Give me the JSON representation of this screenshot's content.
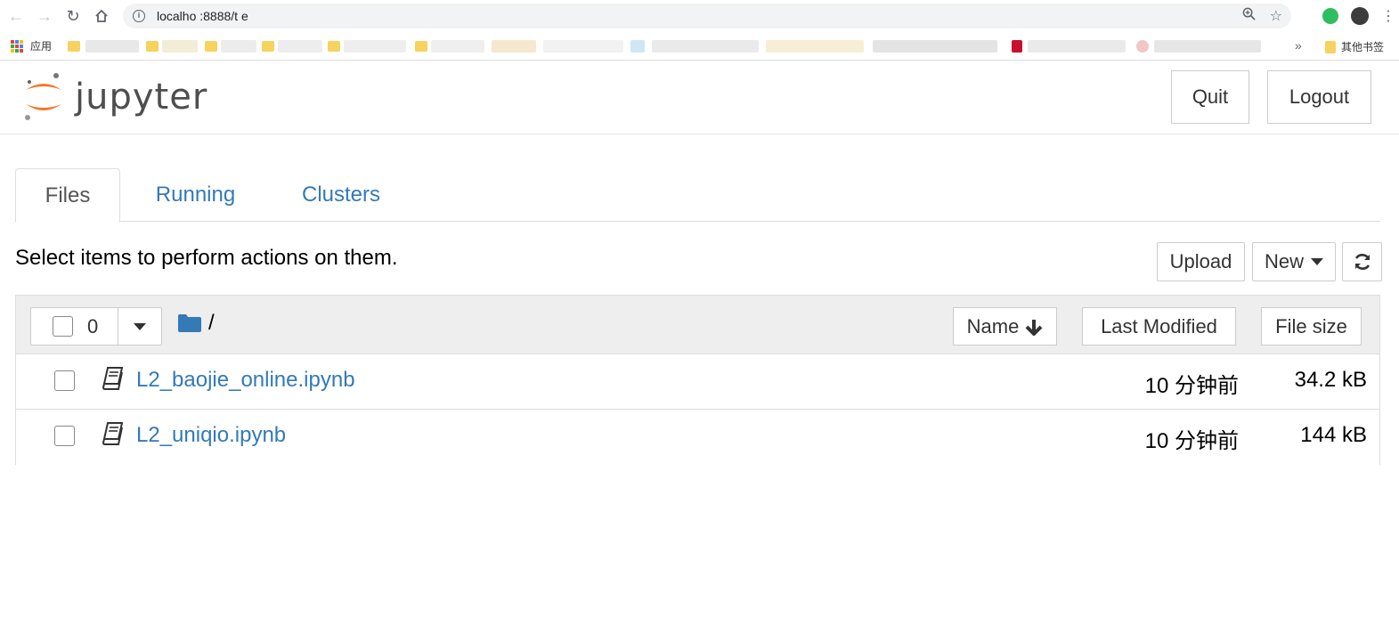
{
  "browser": {
    "url": "localho  :8888/t  e",
    "bookmarks_apps_label": "应用",
    "bookmarks_other_label": "其他书签",
    "bookmarks_more": "»"
  },
  "header": {
    "logo_text": "jupyter",
    "quit_label": "Quit",
    "logout_label": "Logout"
  },
  "tabs": [
    {
      "label": "Files",
      "active": true
    },
    {
      "label": "Running",
      "active": false
    },
    {
      "label": "Clusters",
      "active": false
    }
  ],
  "actions": {
    "hint": "Select items to perform actions on them.",
    "upload_label": "Upload",
    "new_label": "New"
  },
  "file_list": {
    "selected_count": "0",
    "breadcrumb": "/",
    "columns": {
      "name": "Name",
      "last_modified": "Last Modified",
      "file_size": "File size"
    },
    "rows": [
      {
        "name": "L2_baojie_online.ipynb",
        "modified": "10 分钟前",
        "size": "34.2 kB"
      },
      {
        "name": "L2_uniqio.ipynb",
        "modified": "10 分钟前",
        "size": "144 kB"
      }
    ]
  },
  "colors": {
    "link": "#337ab7",
    "jupyter_orange": "#f37726",
    "folder_blue": "#337ab7"
  }
}
